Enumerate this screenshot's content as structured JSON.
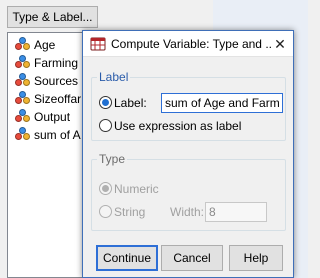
{
  "background": {
    "type_label_button": "Type & Label...",
    "variables": [
      {
        "name": "Age"
      },
      {
        "name": "Farming"
      },
      {
        "name": "Sources"
      },
      {
        "name": "Sizeoffar"
      },
      {
        "name": "Output"
      },
      {
        "name": "sum of A"
      }
    ]
  },
  "dialog": {
    "title": "Compute Variable: Type and ...",
    "label_group": {
      "legend": "Label",
      "label_option": "Label:",
      "label_value": "sum of Age and Farm",
      "expression_option": "Use expression as label"
    },
    "type_group": {
      "legend": "Type",
      "numeric_option": "Numeric",
      "string_option": "String",
      "width_label": "Width:",
      "width_value": "8"
    },
    "buttons": {
      "continue": "Continue",
      "cancel": "Cancel",
      "help": "Help"
    }
  },
  "colors": {
    "accent": "#2e6fd6",
    "legend_blue": "#2a5caa"
  }
}
